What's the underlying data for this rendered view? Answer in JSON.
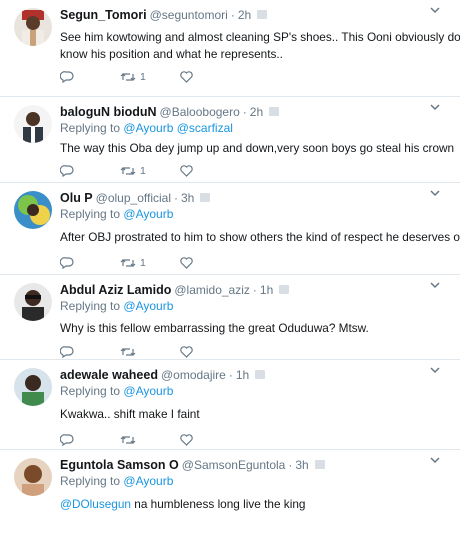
{
  "reply_prefix": "Replying to",
  "tweets": [
    {
      "name": "Segun_Tomori",
      "handle": "@seguntomori",
      "separator": "·",
      "time": "2h",
      "replying_to": null,
      "text": "See him kowtowing and almost cleaning SP's shoes.. This Ooni obviously don't",
      "text_line2": "know his position and what he represents..",
      "retweet_count": "1",
      "avatar_colors": [
        "#7a2d1e",
        "#c9a27a",
        "#2b2b2b"
      ]
    },
    {
      "name": "baloguN bioduN",
      "handle": "@Baloobogero",
      "separator": "·",
      "time": "2h",
      "replying_to": [
        "@Ayourb",
        "@scarfizal"
      ],
      "text": "The way this Oba dey jump up and down,very soon  boys go steal his crown",
      "retweet_count": "1",
      "avatar_colors": [
        "#f2f2f2",
        "#4a3426",
        "#dcdcdc"
      ]
    },
    {
      "name": "Olu P",
      "handle": "@olup_official",
      "separator": "·",
      "time": "3h",
      "replying_to": [
        "@Ayourb"
      ],
      "text": "After OBJ prostrated to him to show others the kind of respect he deserves o.",
      "retweet_count": "1",
      "avatar_colors": [
        "#7dc44a",
        "#3a8fc9",
        "#f0d24a"
      ]
    },
    {
      "name": "Abdul Aziz Lamido",
      "handle": "@lamido_aziz",
      "separator": "·",
      "time": "1h",
      "replying_to": [
        "@Ayourb"
      ],
      "text": "Why is this fellow embarrassing the great Oduduwa? Mtsw.",
      "retweet_count": "",
      "avatar_colors": [
        "#e8e8e8",
        "#3d2a20",
        "#111111"
      ]
    },
    {
      "name": "adewale waheed",
      "handle": "@omodajire",
      "separator": "·",
      "time": "1h",
      "replying_to": [
        "@Ayourb"
      ],
      "text": "Kwakwa.. shift make I faint",
      "retweet_count": "",
      "avatar_colors": [
        "#d7e3ea",
        "#3b2a22",
        "#3f8a4c"
      ]
    },
    {
      "name": "Eguntola Samson O",
      "handle": "@SamsonEguntola",
      "separator": "·",
      "time": "3h",
      "replying_to": [
        "@Ayourb"
      ],
      "text_mention": "@DOlusegun",
      "text": " na humbleness long live the king",
      "retweet_count": "",
      "avatar_colors": [
        "#e6d3c0",
        "#7a4b2a",
        "#cfa07b"
      ]
    }
  ]
}
